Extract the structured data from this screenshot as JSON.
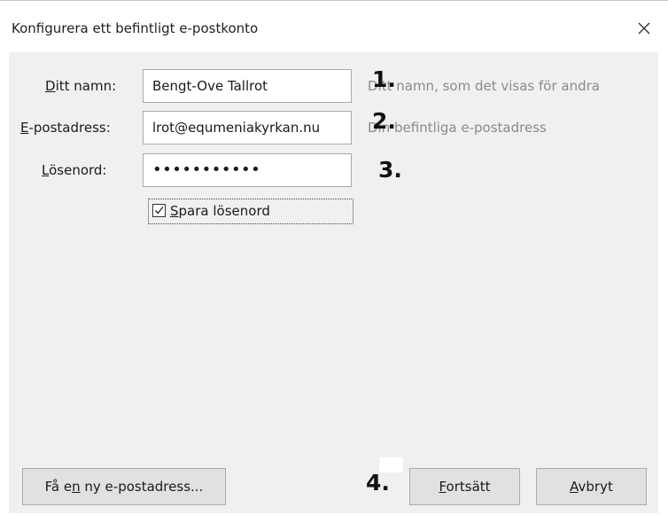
{
  "window": {
    "title": "Konfigurera ett befintligt e-postkonto"
  },
  "form": {
    "name_label_key": "D",
    "name_label_rest": "itt namn:",
    "name_value": "Bengt-Ove Tallrot",
    "name_hint": "Ditt namn, som det visas för andra",
    "email_label_key": "E",
    "email_label_rest": "-postadress:",
    "email_value": "lrot@equmeniakyrkan.nu",
    "email_hint": "Din befintliga e-postadress",
    "password_label_key": "L",
    "password_label_rest": "ösenord:",
    "password_value": "•••••••••••",
    "remember_label_key": "S",
    "remember_label_rest": "para lösenord",
    "remember_checked": true
  },
  "markers": {
    "one": "1.",
    "two": "2.",
    "three": "3.",
    "four": "4."
  },
  "buttons": {
    "new_address_pre": "Få e",
    "new_address_key": "n",
    "new_address_post": " ny e-postadress...",
    "continue_key": "F",
    "continue_rest": "ortsätt",
    "cancel_key": "A",
    "cancel_rest": "vbryt"
  }
}
